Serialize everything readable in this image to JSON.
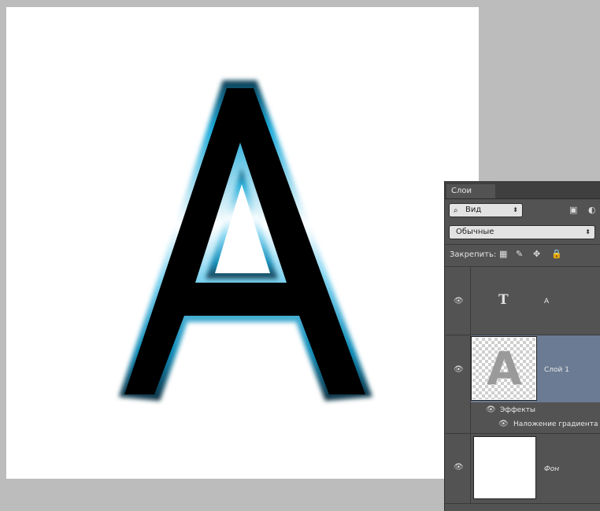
{
  "canvas": {
    "glyph_text": "A",
    "background": "#ffffff",
    "glow_color": "#1aa9d8"
  },
  "panel": {
    "tab_label": "Слои",
    "filter_select": {
      "value": "Вид"
    },
    "blend_mode_select": {
      "value": "Обычные"
    },
    "lock_label": "Закрепить:",
    "lock_icons": [
      "transparency-lock-icon",
      "brush-lock-icon",
      "move-lock-icon",
      "padlock-icon"
    ],
    "layers": [
      {
        "name": "A",
        "kind": "text",
        "thumb_glyph": "T",
        "visible": true,
        "selected": false
      },
      {
        "name": "Слой 1",
        "kind": "pixel",
        "thumb_glyph": "A",
        "visible": true,
        "selected": true,
        "effects_label": "Эффекты",
        "effects": [
          "Наложение градиента"
        ]
      },
      {
        "name": "Фон",
        "kind": "background",
        "visible": true,
        "selected": false
      }
    ],
    "selected_color": "#6a7b93"
  }
}
